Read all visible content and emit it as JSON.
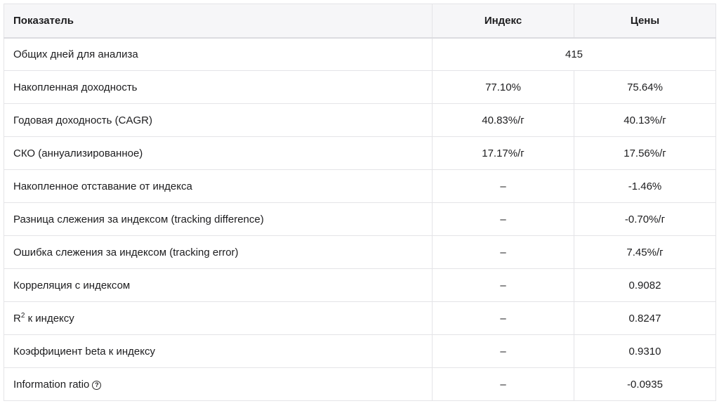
{
  "table": {
    "headers": [
      "Показатель",
      "Индекс",
      "Цены"
    ],
    "days_row": {
      "label": "Общих дней для анализа",
      "value": "415"
    },
    "rows": [
      {
        "label": "Накопленная доходность",
        "index": "77.10%",
        "prices": "75.64%"
      },
      {
        "label": "Годовая доходность (CAGR)",
        "index": "40.83%/г",
        "prices": "40.13%/г"
      },
      {
        "label": "СКО (аннуализированное)",
        "index": "17.17%/г",
        "prices": "17.56%/г"
      },
      {
        "label": "Накопленное отставание от индекса",
        "index": "–",
        "prices": "-1.46%"
      },
      {
        "label": "Разница слежения за индексом (tracking difference)",
        "index": "–",
        "prices": "-0.70%/г"
      },
      {
        "label": "Ошибка слежения за индексом (tracking error)",
        "index": "–",
        "prices": "7.45%/г"
      },
      {
        "label": "Корреляция с индексом",
        "index": "–",
        "prices": "0.9082"
      },
      {
        "label_main": "R",
        "label_sup": "2",
        "label_rest": " к индексу",
        "index": "–",
        "prices": "0.8247"
      },
      {
        "label": "Коэффициент beta к индексу",
        "index": "–",
        "prices": "0.9310"
      },
      {
        "label": "Information ratio",
        "help_icon": "question-circle-icon",
        "help_glyph": "?",
        "index": "–",
        "prices": "-0.0935"
      }
    ]
  }
}
